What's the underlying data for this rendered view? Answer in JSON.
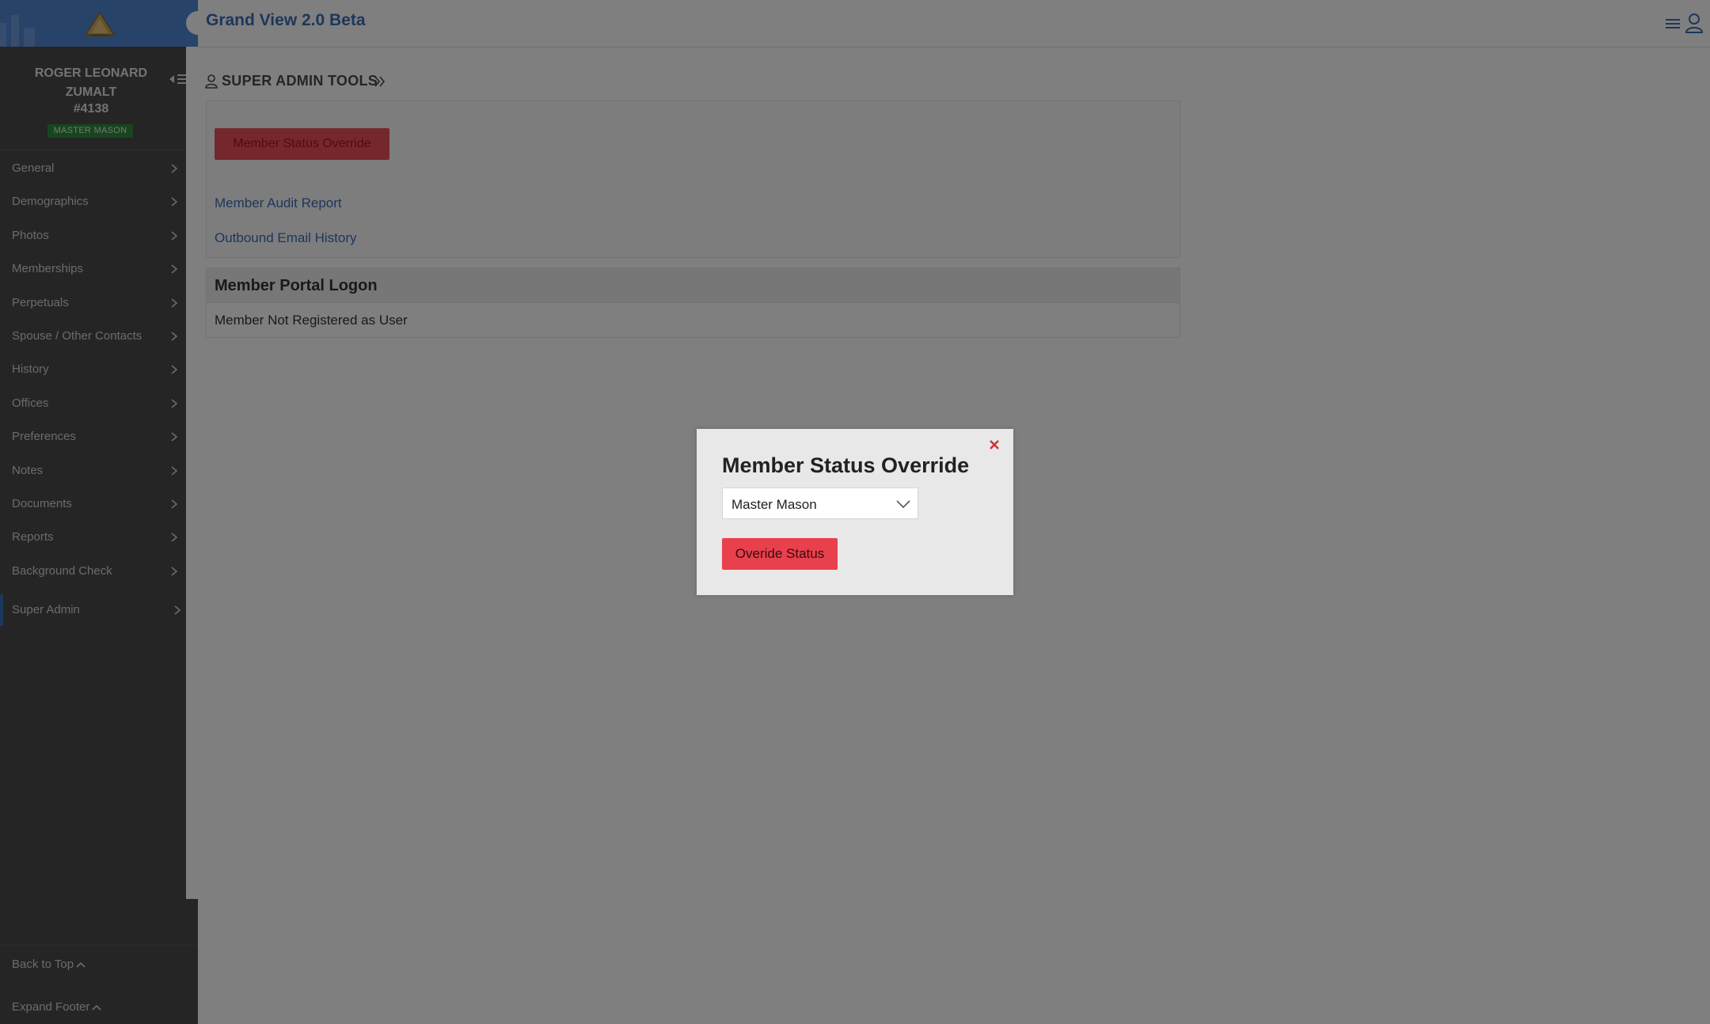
{
  "app": {
    "title": "Grand View 2.0 Beta"
  },
  "member": {
    "name": "ROGER LEONARD ZUMALT",
    "number": "#4138",
    "status_badge": "MASTER MASON"
  },
  "sidebar": {
    "items": [
      {
        "label": "General"
      },
      {
        "label": "Demographics"
      },
      {
        "label": "Photos"
      },
      {
        "label": "Memberships"
      },
      {
        "label": "Perpetuals"
      },
      {
        "label": "Spouse / Other Contacts"
      },
      {
        "label": "History"
      },
      {
        "label": "Offices"
      },
      {
        "label": "Preferences"
      },
      {
        "label": "Notes"
      },
      {
        "label": "Documents"
      },
      {
        "label": "Reports"
      },
      {
        "label": "Background Check"
      },
      {
        "label": "Super Admin"
      }
    ],
    "active_item": "Super Admin",
    "back_to_top": "Back to Top",
    "expand_footer": "Expand Footer"
  },
  "main": {
    "section_title": "SUPER ADMIN TOOLS",
    "override_button": "Member Status Override",
    "links": [
      "Member Audit Report",
      "Outbound Email History"
    ],
    "portal": {
      "heading": "Member Portal Logon",
      "status": "Member Not Registered as User"
    }
  },
  "modal": {
    "title": "Member Status Override",
    "select_value": "Master Mason",
    "submit_label": "Overide Status"
  },
  "colors": {
    "brand_blue": "#3a6fb7",
    "sidebar_bg": "#4a4a4a",
    "danger_red": "#e8404c",
    "badge_green": "#2e8b3c"
  }
}
